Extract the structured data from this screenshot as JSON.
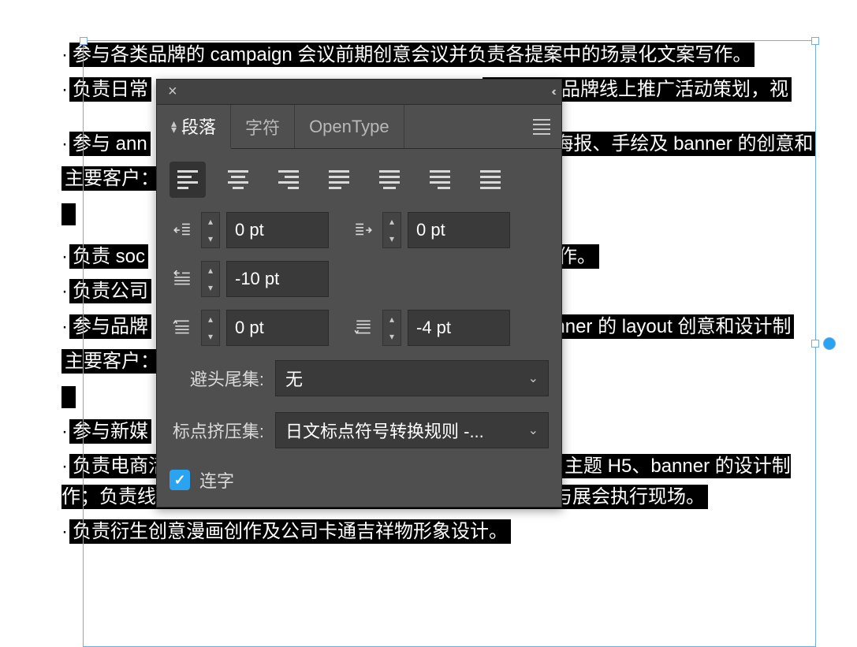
{
  "doc": {
    "lines": [
      "参与各类品牌的 campaign 会议前期创意会议并负责各提案中的场景化文案写作。",
      "负责日常",
      "目结合的品牌线上推广活动策划，视",
      "参与 ann",
      "、H5、海报、手绘及 banner 的创意和",
      "主要客户：",
      "负责 soc",
      "和设计制作。",
      "负责公司",
      "参与品牌",
      "5 和 banner 的 layout 创意和设计制",
      "主要客户：",
      "参与新媒",
      "负责电商活动推广中视觉创意及活动交互内容、相关网页、主题 H5、banner 的设计制作；负责线下季度主题活动海报等印刷物料的设计制作并参与展会执行现场。",
      "负责衍生创意漫画创作及公司卡通吉祥物形象设计。"
    ]
  },
  "panel": {
    "tabs": {
      "paragraph": "段落",
      "character": "字符",
      "opentype": "OpenType"
    },
    "fields": {
      "left_indent": "0 pt",
      "right_indent": "0 pt",
      "first_line": "-10 pt",
      "space_before": "0 pt",
      "space_after": "-4 pt"
    },
    "kinsoku_label": "避头尾集:",
    "kinsoku_value": "无",
    "mojikumi_label": "标点挤压集:",
    "mojikumi_value": "日文标点符号转换规则 -...",
    "ligature_label": "连字"
  }
}
